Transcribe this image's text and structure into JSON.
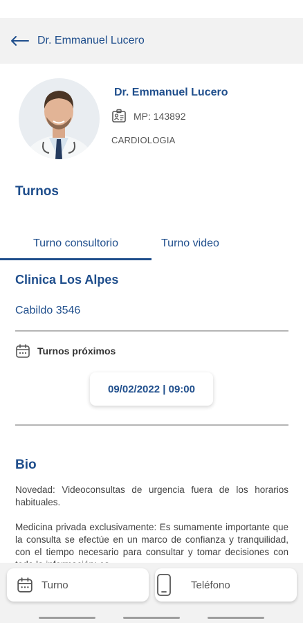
{
  "app_bar": {
    "title": "Dr. Emmanuel Lucero",
    "back_icon": "arrow-left-icon"
  },
  "profile": {
    "name": "Dr. Emmanuel Lucero",
    "license": "MP: 143892",
    "specialty": "CARDIOLOGIA",
    "license_icon": "id-card-icon"
  },
  "turnos": {
    "title": "Turnos",
    "tabs": [
      {
        "label": "Turno consultorio",
        "selected": true
      },
      {
        "label": "Turno video",
        "selected": false
      }
    ],
    "clinic": {
      "name": "Clinica Los Alpes",
      "address": "Cabildo 3546"
    },
    "upcoming_label": "Turnos próximos",
    "upcoming_icon": "calendar-icon",
    "slots": [
      "09/02/2022 | 09:00"
    ]
  },
  "bio": {
    "title": "Bio",
    "paragraphs": [
      "Novedad: Videoconsultas de urgencia fuera de los horarios habituales.",
      "Medicina privada exclusivamente: Es sumamente importante que la consulta se efectúe en un marco de confianza y tranquilidad, con el tiempo necesario para consultar y tomar decisiones con toda la información; es"
    ]
  },
  "actions": [
    {
      "label": "Turno",
      "icon": "calendar-icon"
    },
    {
      "label": "Teléfono",
      "icon": "phone-icon"
    }
  ],
  "colors": {
    "primary": "#1f4e8c",
    "background": "#ffffff",
    "bar": "#f2f2f2",
    "divider": "#b5b5b5"
  }
}
